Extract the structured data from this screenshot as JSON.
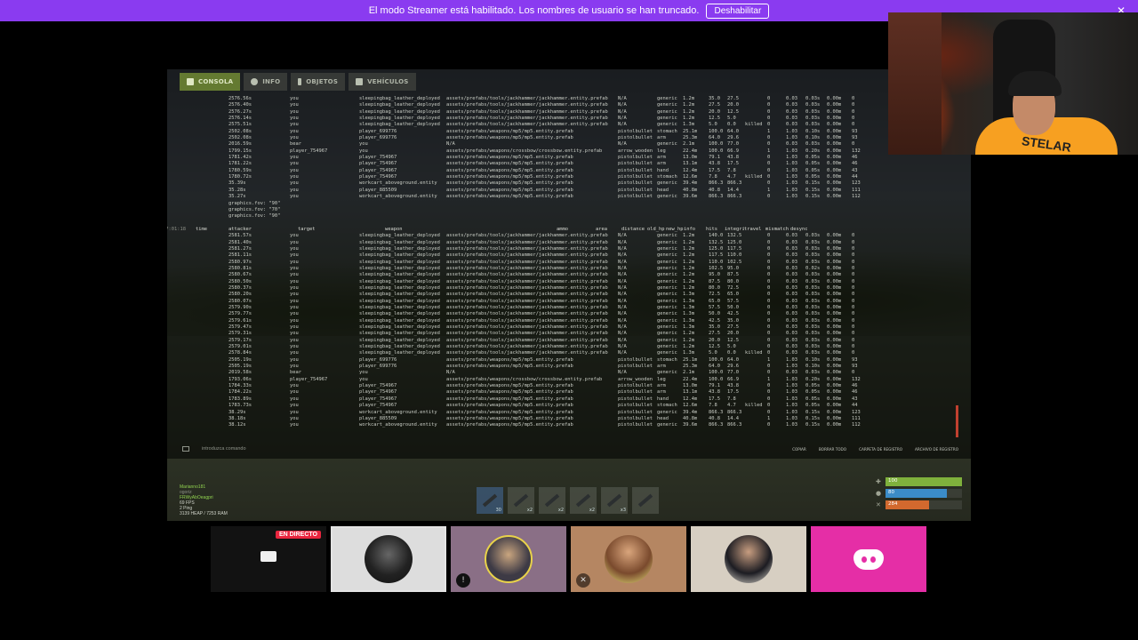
{
  "banner": {
    "text": "El modo Streamer está habilitado. Los nombres de usuario se han truncado.",
    "button": "Deshabilitar",
    "close": "✕"
  },
  "console": {
    "tabs": [
      {
        "label": "CONSOLA"
      },
      {
        "label": "INFO"
      },
      {
        "label": "OBJETOS"
      },
      {
        "label": "VEHÍCULOS"
      }
    ],
    "headers": [
      "time",
      "attacker",
      "target",
      "weapon",
      "ammo",
      "area",
      "distance",
      "old_hp",
      "new_hp",
      "info",
      "hits",
      "integrity",
      "travel",
      "mismatch",
      "desync"
    ],
    "timestamp": "17:01:18",
    "block1": [
      [
        "2576.56s",
        "you",
        "sleepingbag_leather_deployed",
        "assets/prefabs/tools/jackhammer/jackhammer.entity.prefab",
        "N/A",
        "generic",
        "1.2m",
        "35.0",
        "27.5",
        "",
        "0",
        "0.03",
        "0.03s",
        "0.00m",
        "0"
      ],
      [
        "2576.40s",
        "you",
        "sleepingbag_leather_deployed",
        "assets/prefabs/tools/jackhammer/jackhammer.entity.prefab",
        "N/A",
        "generic",
        "1.2m",
        "27.5",
        "20.0",
        "",
        "0",
        "0.03",
        "0.03s",
        "0.00m",
        "0"
      ],
      [
        "2576.27s",
        "you",
        "sleepingbag_leather_deployed",
        "assets/prefabs/tools/jackhammer/jackhammer.entity.prefab",
        "N/A",
        "generic",
        "1.2m",
        "20.0",
        "12.5",
        "",
        "0",
        "0.03",
        "0.03s",
        "0.00m",
        "0"
      ],
      [
        "2576.14s",
        "you",
        "sleepingbag_leather_deployed",
        "assets/prefabs/tools/jackhammer/jackhammer.entity.prefab",
        "N/A",
        "generic",
        "1.2m",
        "12.5",
        "5.0",
        "",
        "0",
        "0.03",
        "0.03s",
        "0.00m",
        "0"
      ],
      [
        "2575.51s",
        "you",
        "sleepingbag_leather_deployed",
        "assets/prefabs/tools/jackhammer/jackhammer.entity.prefab",
        "N/A",
        "generic",
        "1.3m",
        "5.0",
        "0.0",
        "killed",
        "0",
        "0.03",
        "0.03s",
        "0.00m",
        "0"
      ],
      [
        "2502.08s",
        "you",
        "player_699776",
        "assets/prefabs/weapons/mp5/mp5.entity.prefab",
        "pistolbullet",
        "stomach",
        "25.1m",
        "100.0",
        "64.0",
        "",
        "1",
        "1.03",
        "0.10s",
        "0.00m",
        "93"
      ],
      [
        "2502.08s",
        "you",
        "player_699776",
        "assets/prefabs/weapons/mp5/mp5.entity.prefab",
        "pistolbullet",
        "arm",
        "25.3m",
        "64.0",
        "29.6",
        "",
        "0",
        "1.03",
        "0.10s",
        "0.00m",
        "93"
      ],
      [
        "2016.59s",
        "bear",
        "you",
        "N/A",
        "N/A",
        "generic",
        "2.1m",
        "100.0",
        "77.0",
        "",
        "0",
        "0.03",
        "0.03s",
        "0.00m",
        "0"
      ],
      [
        "1799.15s",
        "player_754967",
        "you",
        "assets/prefabs/weapons/crossbow/crossbow.entity.prefab",
        "arrow_wooden",
        "leg",
        "22.4m",
        "100.0",
        "66.9",
        "",
        "1",
        "1.03",
        "0.20s",
        "0.00m",
        "132"
      ],
      [
        "1781.42s",
        "you",
        "player_754967",
        "assets/prefabs/weapons/mp5/mp5.entity.prefab",
        "pistolbullet",
        "arm",
        "13.0m",
        "79.1",
        "43.8",
        "",
        "0",
        "1.03",
        "0.05s",
        "0.00m",
        "46"
      ],
      [
        "1781.22s",
        "you",
        "player_754967",
        "assets/prefabs/weapons/mp5/mp5.entity.prefab",
        "pistolbullet",
        "arm",
        "13.1m",
        "43.8",
        "17.5",
        "",
        "0",
        "1.03",
        "0.05s",
        "0.00m",
        "46"
      ],
      [
        "1780.59s",
        "you",
        "player_754967",
        "assets/prefabs/weapons/mp5/mp5.entity.prefab",
        "pistolbullet",
        "hand",
        "12.4m",
        "17.5",
        "7.8",
        "",
        "0",
        "1.03",
        "0.05s",
        "0.00m",
        "43"
      ],
      [
        "1780.72s",
        "you",
        "player_754967",
        "assets/prefabs/weapons/mp5/mp5.entity.prefab",
        "pistolbullet",
        "stomach",
        "12.6m",
        "7.8",
        "4.7",
        "killed",
        "0",
        "1.03",
        "0.05s",
        "0.00m",
        "44"
      ],
      [
        "35.39s",
        "you",
        "workcart_aboveground.entity",
        "assets/prefabs/weapons/mp5/mp5.entity.prefab",
        "pistolbullet",
        "generic",
        "39.4m",
        "866.3",
        "866.3",
        "",
        "0",
        "1.03",
        "0.15s",
        "0.00m",
        "123"
      ],
      [
        "35.28s",
        "you",
        "player_885509",
        "assets/prefabs/weapons/mp5/mp5.entity.prefab",
        "pistolbullet",
        "head",
        "40.8m",
        "40.8",
        "14.4",
        "",
        "1",
        "1.03",
        "0.15s",
        "0.00m",
        "111"
      ],
      [
        "35.27s",
        "you",
        "workcart_aboveground.entity",
        "assets/prefabs/weapons/mp5/mp5.entity.prefab",
        "pistolbullet",
        "generic",
        "39.6m",
        "866.3",
        "866.3",
        "",
        "0",
        "1.03",
        "0.15s",
        "0.00m",
        "112"
      ]
    ],
    "graphics": [
      "graphics.fov: \"90\"",
      "graphics.fov: \"70\"",
      "graphics.fov: \"90\""
    ],
    "block2": [
      [
        "2581.57s",
        "you",
        "sleepingbag_leather_deployed",
        "assets/prefabs/tools/jackhammer/jackhammer.entity.prefab",
        "N/A",
        "generic",
        "1.2m",
        "140.0",
        "132.5",
        "",
        "0",
        "0.03",
        "0.03s",
        "0.00m",
        "0"
      ],
      [
        "2581.40s",
        "you",
        "sleepingbag_leather_deployed",
        "assets/prefabs/tools/jackhammer/jackhammer.entity.prefab",
        "N/A",
        "generic",
        "1.2m",
        "132.5",
        "125.0",
        "",
        "0",
        "0.03",
        "0.03s",
        "0.00m",
        "0"
      ],
      [
        "2581.27s",
        "you",
        "sleepingbag_leather_deployed",
        "assets/prefabs/tools/jackhammer/jackhammer.entity.prefab",
        "N/A",
        "generic",
        "1.2m",
        "125.0",
        "117.5",
        "",
        "0",
        "0.03",
        "0.03s",
        "0.00m",
        "0"
      ],
      [
        "2581.11s",
        "you",
        "sleepingbag_leather_deployed",
        "assets/prefabs/tools/jackhammer/jackhammer.entity.prefab",
        "N/A",
        "generic",
        "1.2m",
        "117.5",
        "110.0",
        "",
        "0",
        "0.03",
        "0.03s",
        "0.00m",
        "0"
      ],
      [
        "2580.97s",
        "you",
        "sleepingbag_leather_deployed",
        "assets/prefabs/tools/jackhammer/jackhammer.entity.prefab",
        "N/A",
        "generic",
        "1.2m",
        "110.0",
        "102.5",
        "",
        "0",
        "0.03",
        "0.03s",
        "0.00m",
        "0"
      ],
      [
        "2580.81s",
        "you",
        "sleepingbag_leather_deployed",
        "assets/prefabs/tools/jackhammer/jackhammer.entity.prefab",
        "N/A",
        "generic",
        "1.2m",
        "102.5",
        "95.0",
        "",
        "0",
        "0.03",
        "0.02s",
        "0.00m",
        "0"
      ],
      [
        "2580.67s",
        "you",
        "sleepingbag_leather_deployed",
        "assets/prefabs/tools/jackhammer/jackhammer.entity.prefab",
        "N/A",
        "generic",
        "1.2m",
        "95.0",
        "87.5",
        "",
        "0",
        "0.03",
        "0.03s",
        "0.00m",
        "0"
      ],
      [
        "2580.50s",
        "you",
        "sleepingbag_leather_deployed",
        "assets/prefabs/tools/jackhammer/jackhammer.entity.prefab",
        "N/A",
        "generic",
        "1.2m",
        "87.5",
        "80.0",
        "",
        "0",
        "0.03",
        "0.03s",
        "0.00m",
        "0"
      ],
      [
        "2580.37s",
        "you",
        "sleepingbag_leather_deployed",
        "assets/prefabs/tools/jackhammer/jackhammer.entity.prefab",
        "N/A",
        "generic",
        "1.2m",
        "80.0",
        "72.5",
        "",
        "0",
        "0.03",
        "0.03s",
        "0.00m",
        "0"
      ],
      [
        "2580.20s",
        "you",
        "sleepingbag_leather_deployed",
        "assets/prefabs/tools/jackhammer/jackhammer.entity.prefab",
        "N/A",
        "generic",
        "1.3m",
        "72.5",
        "65.0",
        "",
        "0",
        "0.03",
        "0.03s",
        "0.00m",
        "0"
      ],
      [
        "2580.07s",
        "you",
        "sleepingbag_leather_deployed",
        "assets/prefabs/tools/jackhammer/jackhammer.entity.prefab",
        "N/A",
        "generic",
        "1.3m",
        "65.0",
        "57.5",
        "",
        "0",
        "0.03",
        "0.03s",
        "0.00m",
        "0"
      ],
      [
        "2579.90s",
        "you",
        "sleepingbag_leather_deployed",
        "assets/prefabs/tools/jackhammer/jackhammer.entity.prefab",
        "N/A",
        "generic",
        "1.3m",
        "57.5",
        "50.0",
        "",
        "0",
        "0.03",
        "0.03s",
        "0.00m",
        "0"
      ],
      [
        "2579.77s",
        "you",
        "sleepingbag_leather_deployed",
        "assets/prefabs/tools/jackhammer/jackhammer.entity.prefab",
        "N/A",
        "generic",
        "1.3m",
        "50.0",
        "42.5",
        "",
        "0",
        "0.03",
        "0.03s",
        "0.00m",
        "0"
      ],
      [
        "2579.61s",
        "you",
        "sleepingbag_leather_deployed",
        "assets/prefabs/tools/jackhammer/jackhammer.entity.prefab",
        "N/A",
        "generic",
        "1.3m",
        "42.5",
        "35.0",
        "",
        "0",
        "0.03",
        "0.03s",
        "0.00m",
        "0"
      ],
      [
        "2579.47s",
        "you",
        "sleepingbag_leather_deployed",
        "assets/prefabs/tools/jackhammer/jackhammer.entity.prefab",
        "N/A",
        "generic",
        "1.3m",
        "35.0",
        "27.5",
        "",
        "0",
        "0.03",
        "0.03s",
        "0.00m",
        "0"
      ],
      [
        "2579.31s",
        "you",
        "sleepingbag_leather_deployed",
        "assets/prefabs/tools/jackhammer/jackhammer.entity.prefab",
        "N/A",
        "generic",
        "1.2m",
        "27.5",
        "20.0",
        "",
        "0",
        "0.03",
        "0.03s",
        "0.00m",
        "0"
      ],
      [
        "2579.17s",
        "you",
        "sleepingbag_leather_deployed",
        "assets/prefabs/tools/jackhammer/jackhammer.entity.prefab",
        "N/A",
        "generic",
        "1.2m",
        "20.0",
        "12.5",
        "",
        "0",
        "0.03",
        "0.03s",
        "0.00m",
        "0"
      ],
      [
        "2579.01s",
        "you",
        "sleepingbag_leather_deployed",
        "assets/prefabs/tools/jackhammer/jackhammer.entity.prefab",
        "N/A",
        "generic",
        "1.2m",
        "12.5",
        "5.0",
        "",
        "0",
        "0.03",
        "0.03s",
        "0.00m",
        "0"
      ],
      [
        "2578.84s",
        "you",
        "sleepingbag_leather_deployed",
        "assets/prefabs/tools/jackhammer/jackhammer.entity.prefab",
        "N/A",
        "generic",
        "1.3m",
        "5.0",
        "0.0",
        "killed",
        "0",
        "0.03",
        "0.03s",
        "0.00m",
        "0"
      ],
      [
        "2505.19s",
        "you",
        "player_699776",
        "assets/prefabs/weapons/mp5/mp5.entity.prefab",
        "pistolbullet",
        "stomach",
        "25.1m",
        "100.0",
        "64.0",
        "",
        "1",
        "1.03",
        "0.10s",
        "0.00m",
        "93"
      ],
      [
        "2505.19s",
        "you",
        "player_699776",
        "assets/prefabs/weapons/mp5/mp5.entity.prefab",
        "pistolbullet",
        "arm",
        "25.3m",
        "64.0",
        "29.6",
        "",
        "0",
        "1.03",
        "0.10s",
        "0.00m",
        "93"
      ],
      [
        "2019.58s",
        "bear",
        "you",
        "N/A",
        "N/A",
        "generic",
        "2.1m",
        "100.0",
        "77.0",
        "",
        "0",
        "0.03",
        "0.03s",
        "0.00m",
        "0"
      ],
      [
        "1793.06s",
        "player_754967",
        "you",
        "assets/prefabs/weapons/crossbow/crossbow.entity.prefab",
        "arrow_wooden",
        "leg",
        "22.4m",
        "100.0",
        "66.9",
        "",
        "1",
        "1.03",
        "0.20s",
        "0.00m",
        "132"
      ],
      [
        "1784.33s",
        "you",
        "player_754967",
        "assets/prefabs/weapons/mp5/mp5.entity.prefab",
        "pistolbullet",
        "arm",
        "13.0m",
        "79.1",
        "43.8",
        "",
        "0",
        "1.03",
        "0.05s",
        "0.00m",
        "46"
      ],
      [
        "1784.22s",
        "you",
        "player_754967",
        "assets/prefabs/weapons/mp5/mp5.entity.prefab",
        "pistolbullet",
        "arm",
        "13.1m",
        "43.8",
        "17.5",
        "",
        "0",
        "1.03",
        "0.05s",
        "0.00m",
        "46"
      ],
      [
        "1783.89s",
        "you",
        "player_754967",
        "assets/prefabs/weapons/mp5/mp5.entity.prefab",
        "pistolbullet",
        "hand",
        "12.4m",
        "17.5",
        "7.8",
        "",
        "0",
        "1.03",
        "0.05s",
        "0.00m",
        "43"
      ],
      [
        "1783.73s",
        "you",
        "player_754967",
        "assets/prefabs/weapons/mp5/mp5.entity.prefab",
        "pistolbullet",
        "stomach",
        "12.6m",
        "7.8",
        "4.7",
        "killed",
        "0",
        "1.03",
        "0.05s",
        "0.00m",
        "44"
      ],
      [
        "38.29s",
        "you",
        "workcart_aboveground.entity",
        "assets/prefabs/weapons/mp5/mp5.entity.prefab",
        "pistolbullet",
        "generic",
        "39.4m",
        "866.3",
        "866.3",
        "",
        "0",
        "1.03",
        "0.15s",
        "0.00m",
        "123"
      ],
      [
        "38.18s",
        "you",
        "player_885509",
        "assets/prefabs/weapons/mp5/mp5.entity.prefab",
        "pistolbullet",
        "head",
        "40.8m",
        "40.8",
        "14.4",
        "",
        "1",
        "1.03",
        "0.15s",
        "0.00m",
        "111"
      ],
      [
        "38.12s",
        "you",
        "workcart_aboveground.entity",
        "assets/prefabs/weapons/mp5/mp5.entity.prefab",
        "pistolbullet",
        "generic",
        "39.6m",
        "866.3",
        "866.3",
        "",
        "0",
        "1.03",
        "0.15s",
        "0.00m",
        "112"
      ]
    ],
    "input_placeholder": "introduzca comando",
    "buttons": [
      "COPIAR",
      "BORRAR TODO",
      "CARPETA DE REGISTRO",
      "ARCHIVO DE REGISTRO"
    ]
  },
  "hud": {
    "players": [
      {
        "name": "Marianno181"
      },
      {
        "name": "ogoriz"
      },
      {
        "name": "FRWyAbOeagpri"
      }
    ],
    "perf": [
      "69 FPS",
      "2 Ping",
      "3139 HEAP / 7253 RAM"
    ],
    "belt": [
      {
        "qty": "30",
        "selected": true
      },
      {
        "qty": "x2"
      },
      {
        "qty": "x2"
      },
      {
        "qty": "x2"
      },
      {
        "qty": "x3"
      },
      {
        "qty": ""
      }
    ],
    "stats": [
      {
        "value": "100",
        "level": 1.0,
        "color": "#7fb13c",
        "icon": "health-cross-icon"
      },
      {
        "value": "80",
        "level": 0.8,
        "color": "#3b8cc8",
        "icon": "water-drop-icon"
      },
      {
        "value": "284",
        "level": 0.57,
        "color": "#d2692e",
        "icon": "food-icon"
      }
    ]
  },
  "webcam": {
    "shirt_text": "STELAR"
  },
  "participants": [
    {
      "name": "screen-share",
      "live_badge": "EN DIRECTO"
    },
    {
      "name": "participant-2",
      "bg": "#dcdcdc"
    },
    {
      "name": "participant-3",
      "bg": "#8a6f86"
    },
    {
      "name": "participant-4",
      "bg": "#b58662"
    },
    {
      "name": "participant-5",
      "bg": "#d7cfc2"
    },
    {
      "name": "discord",
      "bg": "#e52ea6"
    }
  ]
}
